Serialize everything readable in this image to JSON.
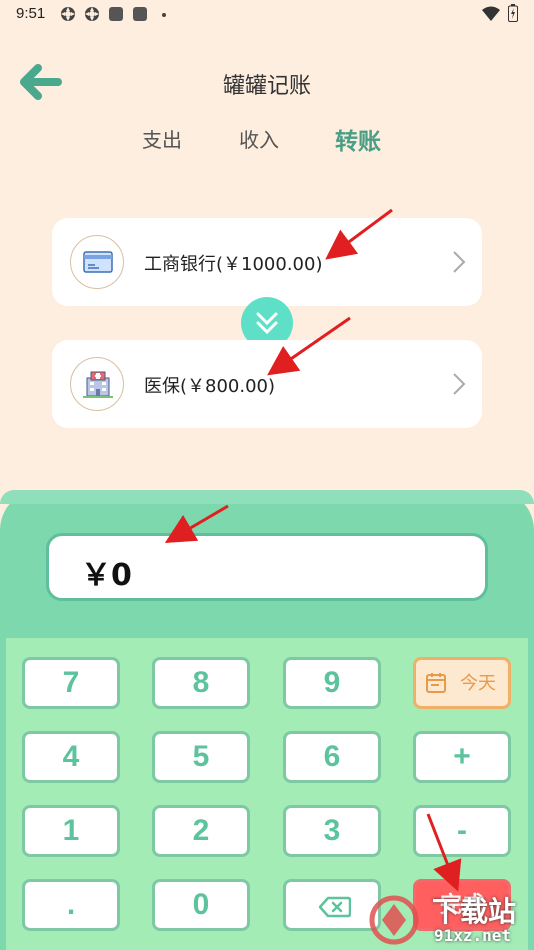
{
  "status_bar": {
    "time": "9:51"
  },
  "header": {
    "title": "罐罐记账"
  },
  "tabs": [
    {
      "label": "支出",
      "active": false
    },
    {
      "label": "收入",
      "active": false
    },
    {
      "label": "转账",
      "active": true
    }
  ],
  "from_account": {
    "label": "工商银行(￥1000.00)",
    "icon": "bank-card-icon"
  },
  "to_account": {
    "label": "医保(￥800.00)",
    "icon": "hospital-icon"
  },
  "amount": {
    "value": "￥0"
  },
  "keypad": {
    "keys": [
      "7",
      "8",
      "9",
      "4",
      "5",
      "6",
      "+",
      "1",
      "2",
      "3",
      "-",
      ".",
      "0"
    ],
    "today_label": "今天",
    "confirm_label": "完成"
  },
  "watermark": {
    "text_top": "下载站",
    "text_bottom": "91xz.net"
  },
  "colors": {
    "background": "#fdeee0",
    "accent": "#4a9e84",
    "swap_button": "#5ee0c8",
    "panel": "#7dd9ad",
    "keypad": "#a3ecb6",
    "annotation": "#e02020"
  }
}
